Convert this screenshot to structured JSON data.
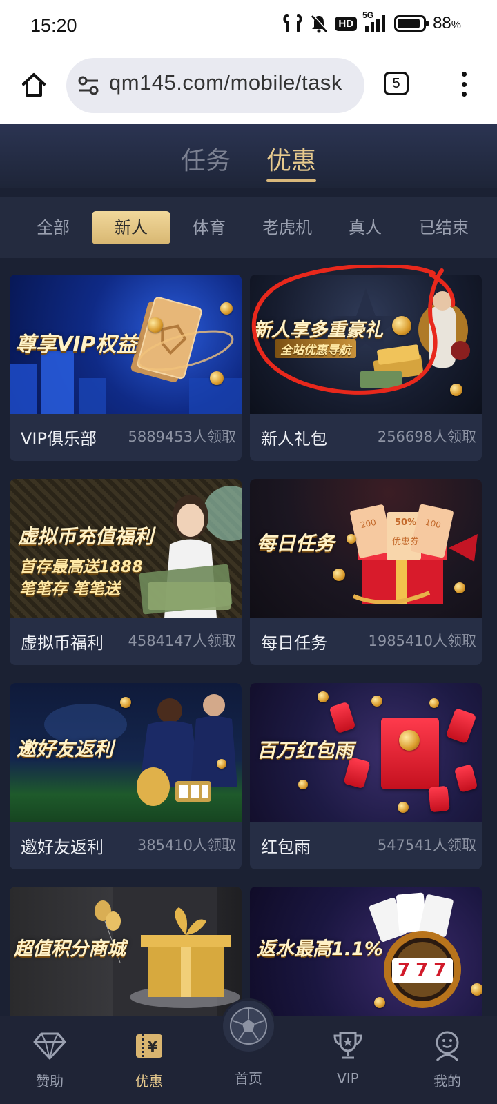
{
  "status": {
    "time": "15:20",
    "battery_pct": "88",
    "pct_sign": "%",
    "net": "5G",
    "hd": "HD"
  },
  "browser": {
    "url": "qm145.com/mobile/task",
    "tab_count": "5"
  },
  "top_tabs": [
    {
      "label": "任务",
      "active": false
    },
    {
      "label": "优惠",
      "active": true
    }
  ],
  "categories": [
    {
      "label": "全部",
      "active": false
    },
    {
      "label": "新人",
      "active": true
    },
    {
      "label": "体育",
      "active": false
    },
    {
      "label": "老虎机",
      "active": false
    },
    {
      "label": "真人",
      "active": false
    },
    {
      "label": "已结束",
      "active": false
    }
  ],
  "cards": [
    {
      "banner_title": "尊享VIP权益",
      "name": "VIP俱乐部",
      "count": "5889453人领取"
    },
    {
      "banner_title": "新人享多重豪礼",
      "banner_sub": "全站优惠导航",
      "name": "新人礼包",
      "count": "256698人领取"
    },
    {
      "banner_title": "虚拟币充值福利",
      "banner_sub": "首存最高送1888",
      "banner_sub2": "笔笔存 笔笔送",
      "name": "虚拟币福利",
      "count": "4584147人领取"
    },
    {
      "banner_title": "每日任务",
      "banner_coupons": [
        "200",
        "50%",
        "100"
      ],
      "banner_coupon_text": "优惠券",
      "name": "每日任务",
      "count": "1985410人领取"
    },
    {
      "banner_title": "邀好友返利",
      "name": "邀好友返利",
      "count": "385410人领取"
    },
    {
      "banner_title": "百万红包雨",
      "name": "红包雨",
      "count": "547541人领取"
    },
    {
      "banner_title": "超值积分商城"
    },
    {
      "banner_title": "返水最高1.1%",
      "slot_digits": "777"
    }
  ],
  "bottom_nav": [
    {
      "label": "赞助",
      "icon": "diamond-icon",
      "active": false
    },
    {
      "label": "优惠",
      "icon": "ticket-icon",
      "active": true
    },
    {
      "label": "首页",
      "icon": "soccer-ball-icon",
      "active": false
    },
    {
      "label": "VIP",
      "icon": "trophy-icon",
      "active": false
    },
    {
      "label": "我的",
      "icon": "smiley-icon",
      "active": false
    }
  ],
  "colors": {
    "accent_gold": "#e6c98d",
    "background": "#1b2133",
    "card": "#262e45",
    "annotation": "#e8281c"
  }
}
